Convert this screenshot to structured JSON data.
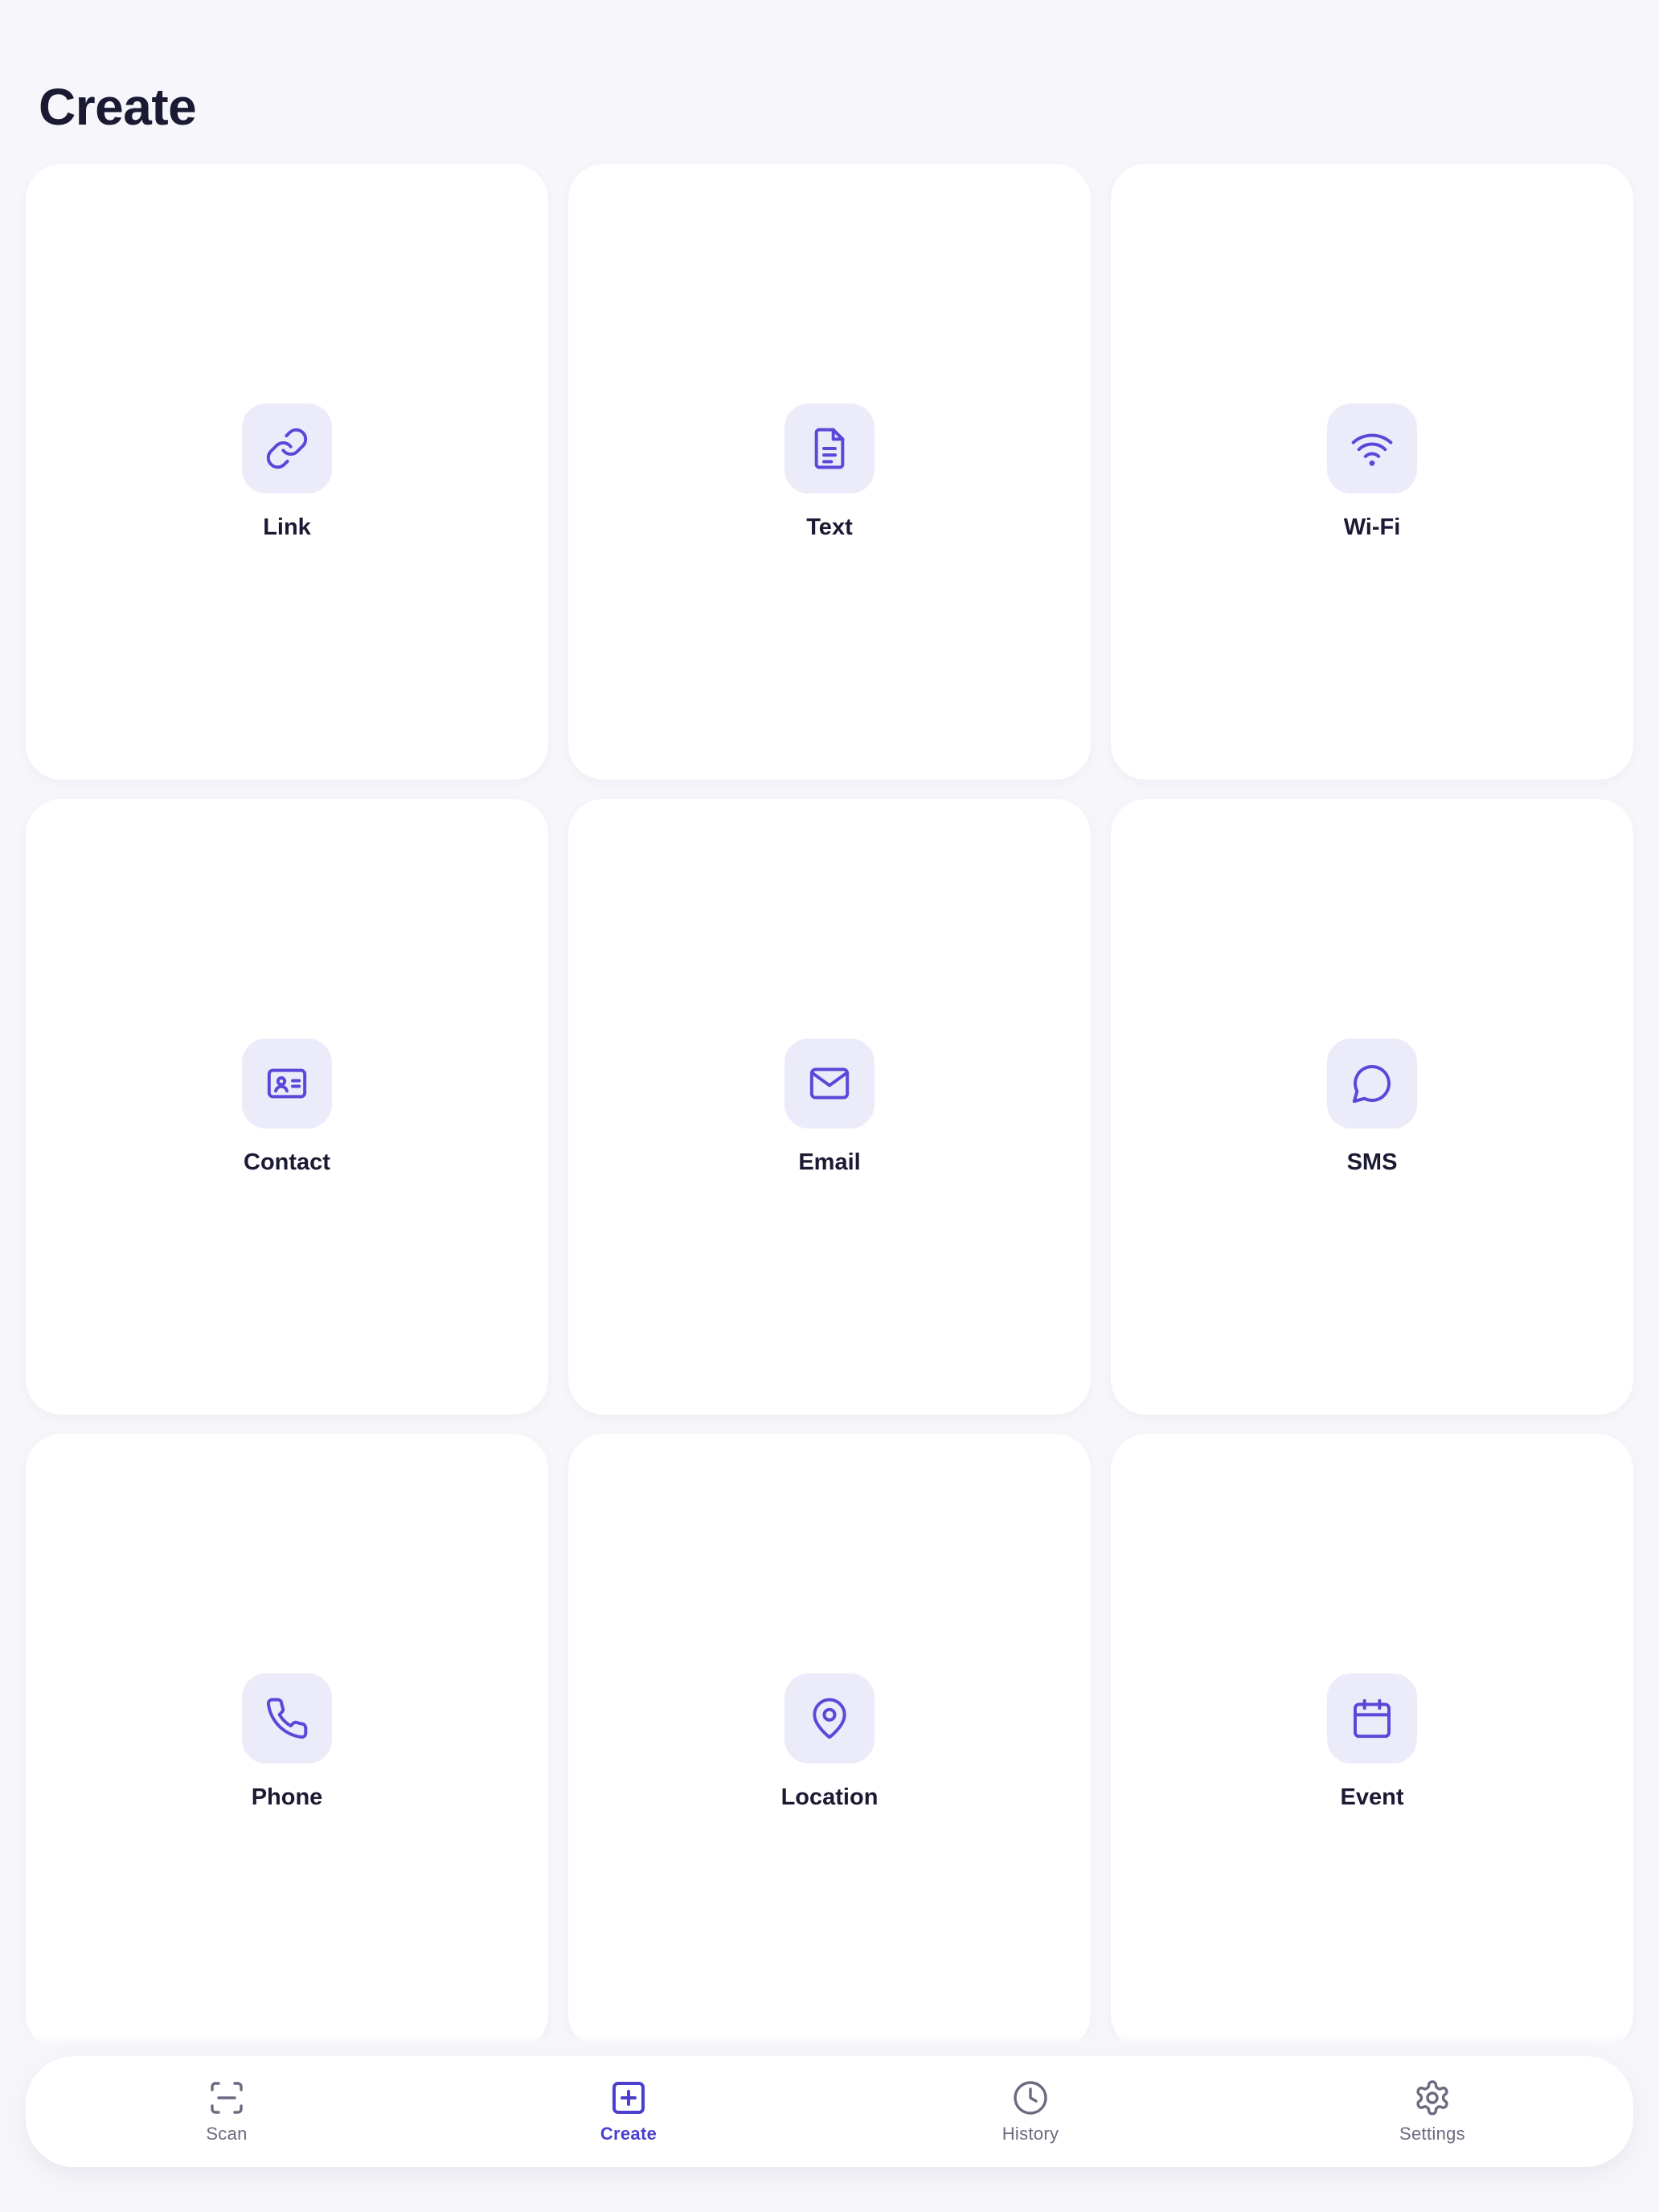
{
  "page": {
    "title": "Create"
  },
  "colors": {
    "accent": "#5b48d9",
    "icon_bg": "#ecebfa",
    "active_tab": "#4b3fcf",
    "inactive_tab": "#6b6a80",
    "background": "#f7f7fb"
  },
  "tiles": [
    {
      "label": "Link",
      "icon": "link-icon"
    },
    {
      "label": "Text",
      "icon": "document-icon"
    },
    {
      "label": "Wi-Fi",
      "icon": "wifi-icon"
    },
    {
      "label": "Contact",
      "icon": "contact-card-icon"
    },
    {
      "label": "Email",
      "icon": "mail-icon"
    },
    {
      "label": "SMS",
      "icon": "chat-bubble-icon"
    },
    {
      "label": "Phone",
      "icon": "phone-icon"
    },
    {
      "label": "Location",
      "icon": "map-pin-icon"
    },
    {
      "label": "Event",
      "icon": "calendar-icon"
    }
  ],
  "tabbar": {
    "active": "Create",
    "tabs": [
      {
        "label": "Scan",
        "icon": "scan-icon"
      },
      {
        "label": "Create",
        "icon": "plus-square-icon"
      },
      {
        "label": "History",
        "icon": "clock-icon"
      },
      {
        "label": "Settings",
        "icon": "gear-icon"
      }
    ]
  }
}
